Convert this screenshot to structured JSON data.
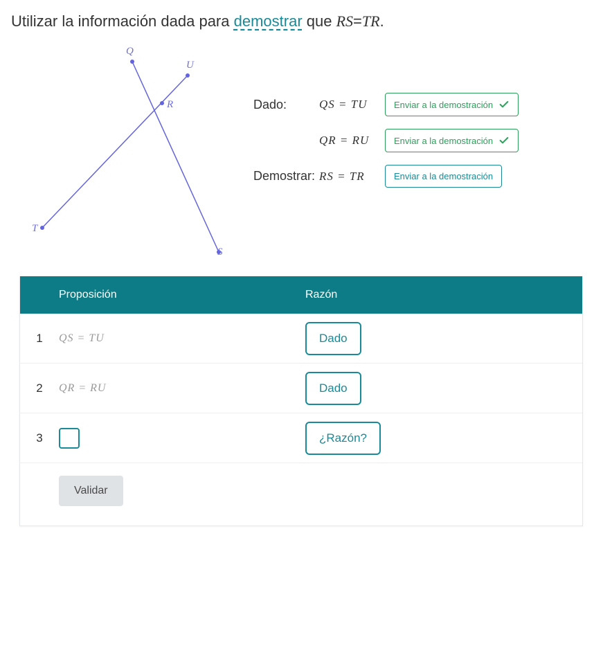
{
  "prompt": {
    "pre": "Utilizar la información dada para ",
    "link": "demostrar",
    "post": " que ",
    "eq_lhs": "RS",
    "eq_op": "=",
    "eq_rhs": "TR",
    "period": "."
  },
  "diagram": {
    "points": {
      "Q": "Q",
      "U": "U",
      "R": "R",
      "T": "T",
      "S": "S"
    }
  },
  "givens": {
    "dado_label": "Dado:",
    "demostrar_label": "Demostrar:",
    "send_label": "Enviar a la demostración",
    "rows": [
      {
        "eq": "QS = TU"
      },
      {
        "eq": "QR = RU"
      },
      {
        "eq": "RS = TR"
      }
    ]
  },
  "table": {
    "hdr_prop": "Proposición",
    "hdr_reason": "Razón",
    "rows": [
      {
        "n": "1",
        "prop": "QS = TU",
        "reason": "Dado"
      },
      {
        "n": "2",
        "prop": "QR = RU",
        "reason": "Dado"
      },
      {
        "n": "3",
        "prop": "",
        "reason": "¿Razón?"
      }
    ],
    "validate": "Validar"
  }
}
